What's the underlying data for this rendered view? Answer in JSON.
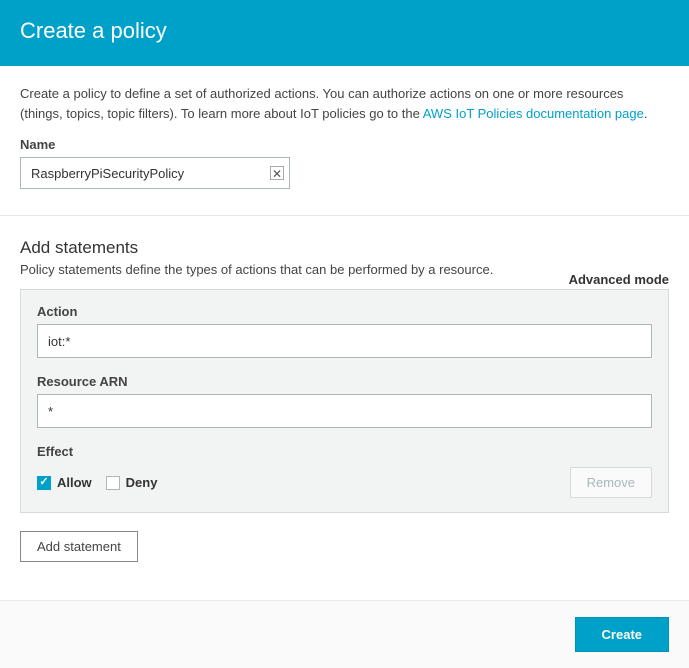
{
  "header": {
    "title": "Create a policy"
  },
  "intro": {
    "text_before": "Create a policy to define a set of authorized actions. You can authorize actions on one or more resources (things, topics, topic filters). To learn more about IoT policies go to the ",
    "link_text": "AWS IoT Policies documentation page",
    "text_after": "."
  },
  "name": {
    "label": "Name",
    "value": "RaspberryPiSecurityPolicy"
  },
  "statements": {
    "heading": "Add statements",
    "description": "Policy statements define the types of actions that can be performed by a resource.",
    "advanced_mode": "Advanced mode",
    "items": [
      {
        "action_label": "Action",
        "action_value": "iot:*",
        "resource_label": "Resource ARN",
        "resource_value": "*",
        "effect_label": "Effect",
        "allow_label": "Allow",
        "allow_checked": true,
        "deny_label": "Deny",
        "deny_checked": false,
        "remove_label": "Remove"
      }
    ],
    "add_statement_label": "Add statement"
  },
  "footer": {
    "create_label": "Create"
  }
}
